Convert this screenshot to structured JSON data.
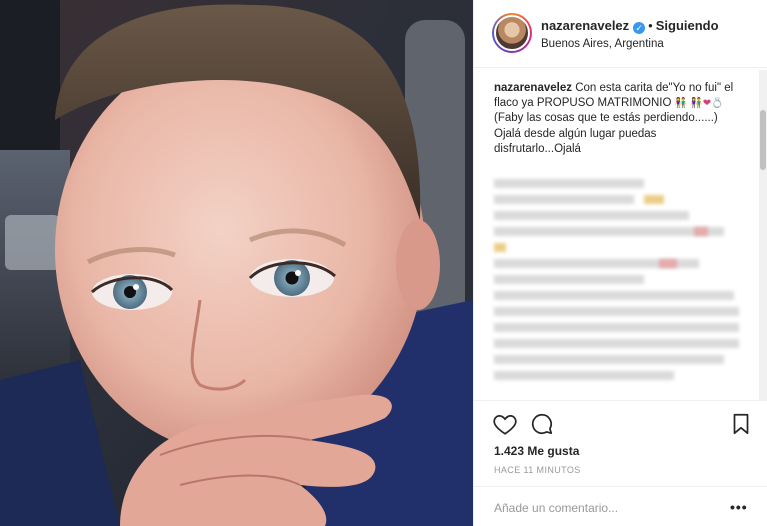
{
  "post": {
    "username": "nazarenavelez",
    "follow_separator": "•",
    "follow_status": "Siguiendo",
    "location": "Buenos Aires, Argentina",
    "verified_glyph": "✓"
  },
  "caption": {
    "username": "nazarenavelez",
    "text_line1": " Con esta carita de\"Yo no fui\" el flaco ya PROPUSO MATRIMONIO",
    "emojis_a": "👫",
    "emojis_b": "👫❤💍",
    "text_line2": " (Faby las cosas que te estás perdiendo......)",
    "text_line3": "Ojalá desde algún lugar puedas disfrutarlo...Ojalá"
  },
  "actions": {
    "likes": "1.423 Me gusta",
    "time": "HACE 11 MINUTOS",
    "comment_placeholder": "Añade un comentario...",
    "more_label": "•••"
  },
  "icons": {
    "like": "heart-icon",
    "comment": "comment-icon",
    "save": "bookmark-icon",
    "verified": "verified-badge-icon",
    "more": "more-options-icon"
  },
  "colors": {
    "verified_blue": "#3897f0",
    "text": "#262626",
    "muted": "#999999",
    "border": "#efefef"
  }
}
